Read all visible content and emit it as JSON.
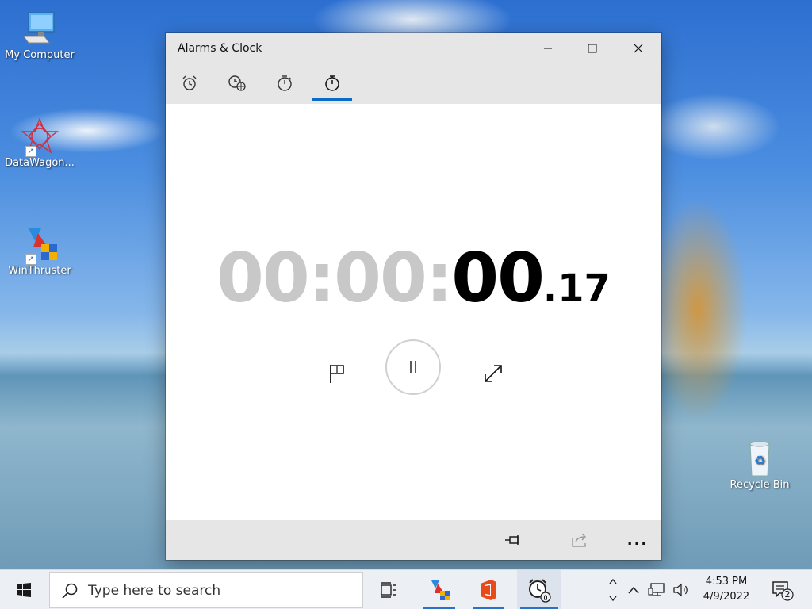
{
  "desktop": {
    "icons": [
      {
        "label": "My Computer"
      },
      {
        "label": "DataWagon..."
      },
      {
        "label": "WinThruster"
      },
      {
        "label": "Recycle Bin"
      }
    ]
  },
  "window": {
    "title": "Alarms & Clock",
    "tabs": [
      {
        "name": "Alarm",
        "icon": "alarm-clock-icon"
      },
      {
        "name": "World Clock",
        "icon": "world-clock-icon"
      },
      {
        "name": "Timer",
        "icon": "timer-icon"
      },
      {
        "name": "Stopwatch",
        "icon": "stopwatch-icon",
        "active": true
      }
    ],
    "stopwatch": {
      "hours": "00",
      "minutes": "00",
      "seconds": "00",
      "centiseconds": ".17",
      "sep": ":"
    },
    "bottom_bar": {
      "more_label": "..."
    }
  },
  "taskbar": {
    "search_placeholder": "Type here to search",
    "time": "4:53 PM",
    "date": "4/9/2022",
    "notification_count": "2"
  },
  "colors": {
    "accent": "#0a6cc2",
    "dim_digits": "#c8c8c8"
  }
}
